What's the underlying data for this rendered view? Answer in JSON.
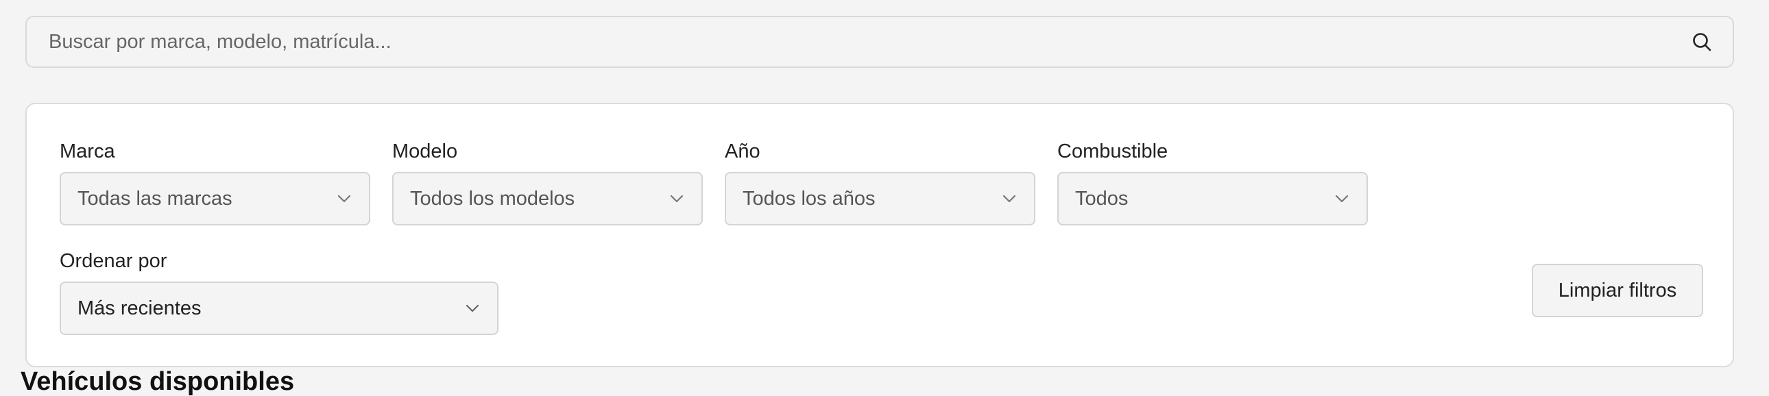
{
  "search": {
    "placeholder": "Buscar por marca, modelo, matrícula...",
    "icon": "search-icon"
  },
  "filters": {
    "brand": {
      "label": "Marca",
      "value": "Todas las marcas"
    },
    "model": {
      "label": "Modelo",
      "value": "Todos los modelos"
    },
    "year": {
      "label": "Año",
      "value": "Todos los años"
    },
    "fuel": {
      "label": "Combustible",
      "value": "Todos"
    },
    "sort": {
      "label": "Ordenar por",
      "value": "Más recientes"
    },
    "clear_label": "Limpiar filtros"
  },
  "results": {
    "heading": "Vehículos disponibles"
  },
  "colors": {
    "page_background": "#f4f4f4",
    "card_background": "#ffffff",
    "border": "#d4d4d4"
  }
}
